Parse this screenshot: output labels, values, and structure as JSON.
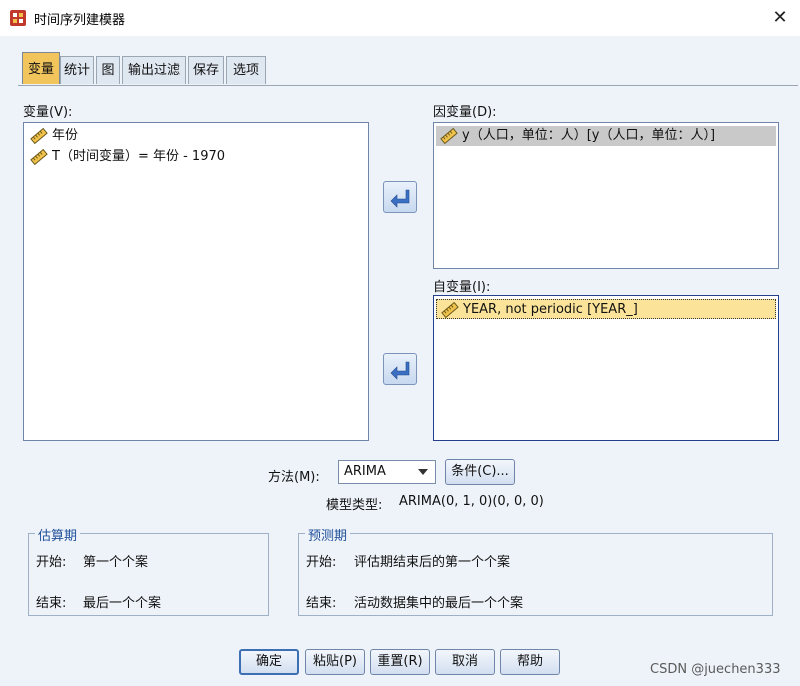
{
  "window": {
    "title": "时间序列建模器",
    "close_glyph": "✕"
  },
  "tabs": [
    {
      "label": "变量",
      "active": true
    },
    {
      "label": "统计"
    },
    {
      "label": "图"
    },
    {
      "label": "输出过滤"
    },
    {
      "label": "保存"
    },
    {
      "label": "选项"
    }
  ],
  "variables": {
    "label": "变量(V):",
    "items": [
      {
        "text": "年份",
        "icon": "ruler-icon"
      },
      {
        "text": "T（时间变量）= 年份 - 1970",
        "icon": "ruler-icon"
      }
    ]
  },
  "dependent": {
    "label": "因变量(D):",
    "items": [
      {
        "text": "y（人口，单位：人）[y（人口，单位：人）]",
        "icon": "ruler-icon",
        "selected": true
      }
    ]
  },
  "independent": {
    "label": "自变量(I):",
    "items": [
      {
        "text": "YEAR, not periodic [YEAR_]",
        "icon": "ruler-icon",
        "selected": true
      }
    ]
  },
  "method": {
    "label": "方法(M):",
    "value": "ARIMA",
    "criteria_button": "条件(C)...",
    "model_type_label": "模型类型:",
    "model_type_value": "ARIMA(0, 1, 0)(0, 0, 0)"
  },
  "estimation": {
    "title": "估算期",
    "start_label": "开始:",
    "start_value": "第一个个案",
    "end_label": "结束:",
    "end_value": "最后一个个案"
  },
  "forecast": {
    "title": "预测期",
    "start_label": "开始:",
    "start_value": "评估期结束后的第一个个案",
    "end_label": "结束:",
    "end_value": "活动数据集中的最后一个个案"
  },
  "buttons": {
    "ok": "确定",
    "paste": "粘贴(P)",
    "reset": "重置(R)",
    "cancel": "取消",
    "help": "帮助"
  },
  "watermark": "CSDN @juechen333",
  "colors": {
    "accent_tab": "#f2c45c",
    "selected_row_gray": "#c9c9c9",
    "selected_row_yellow": "#fbe49a",
    "group_title": "#1f4f9a"
  }
}
